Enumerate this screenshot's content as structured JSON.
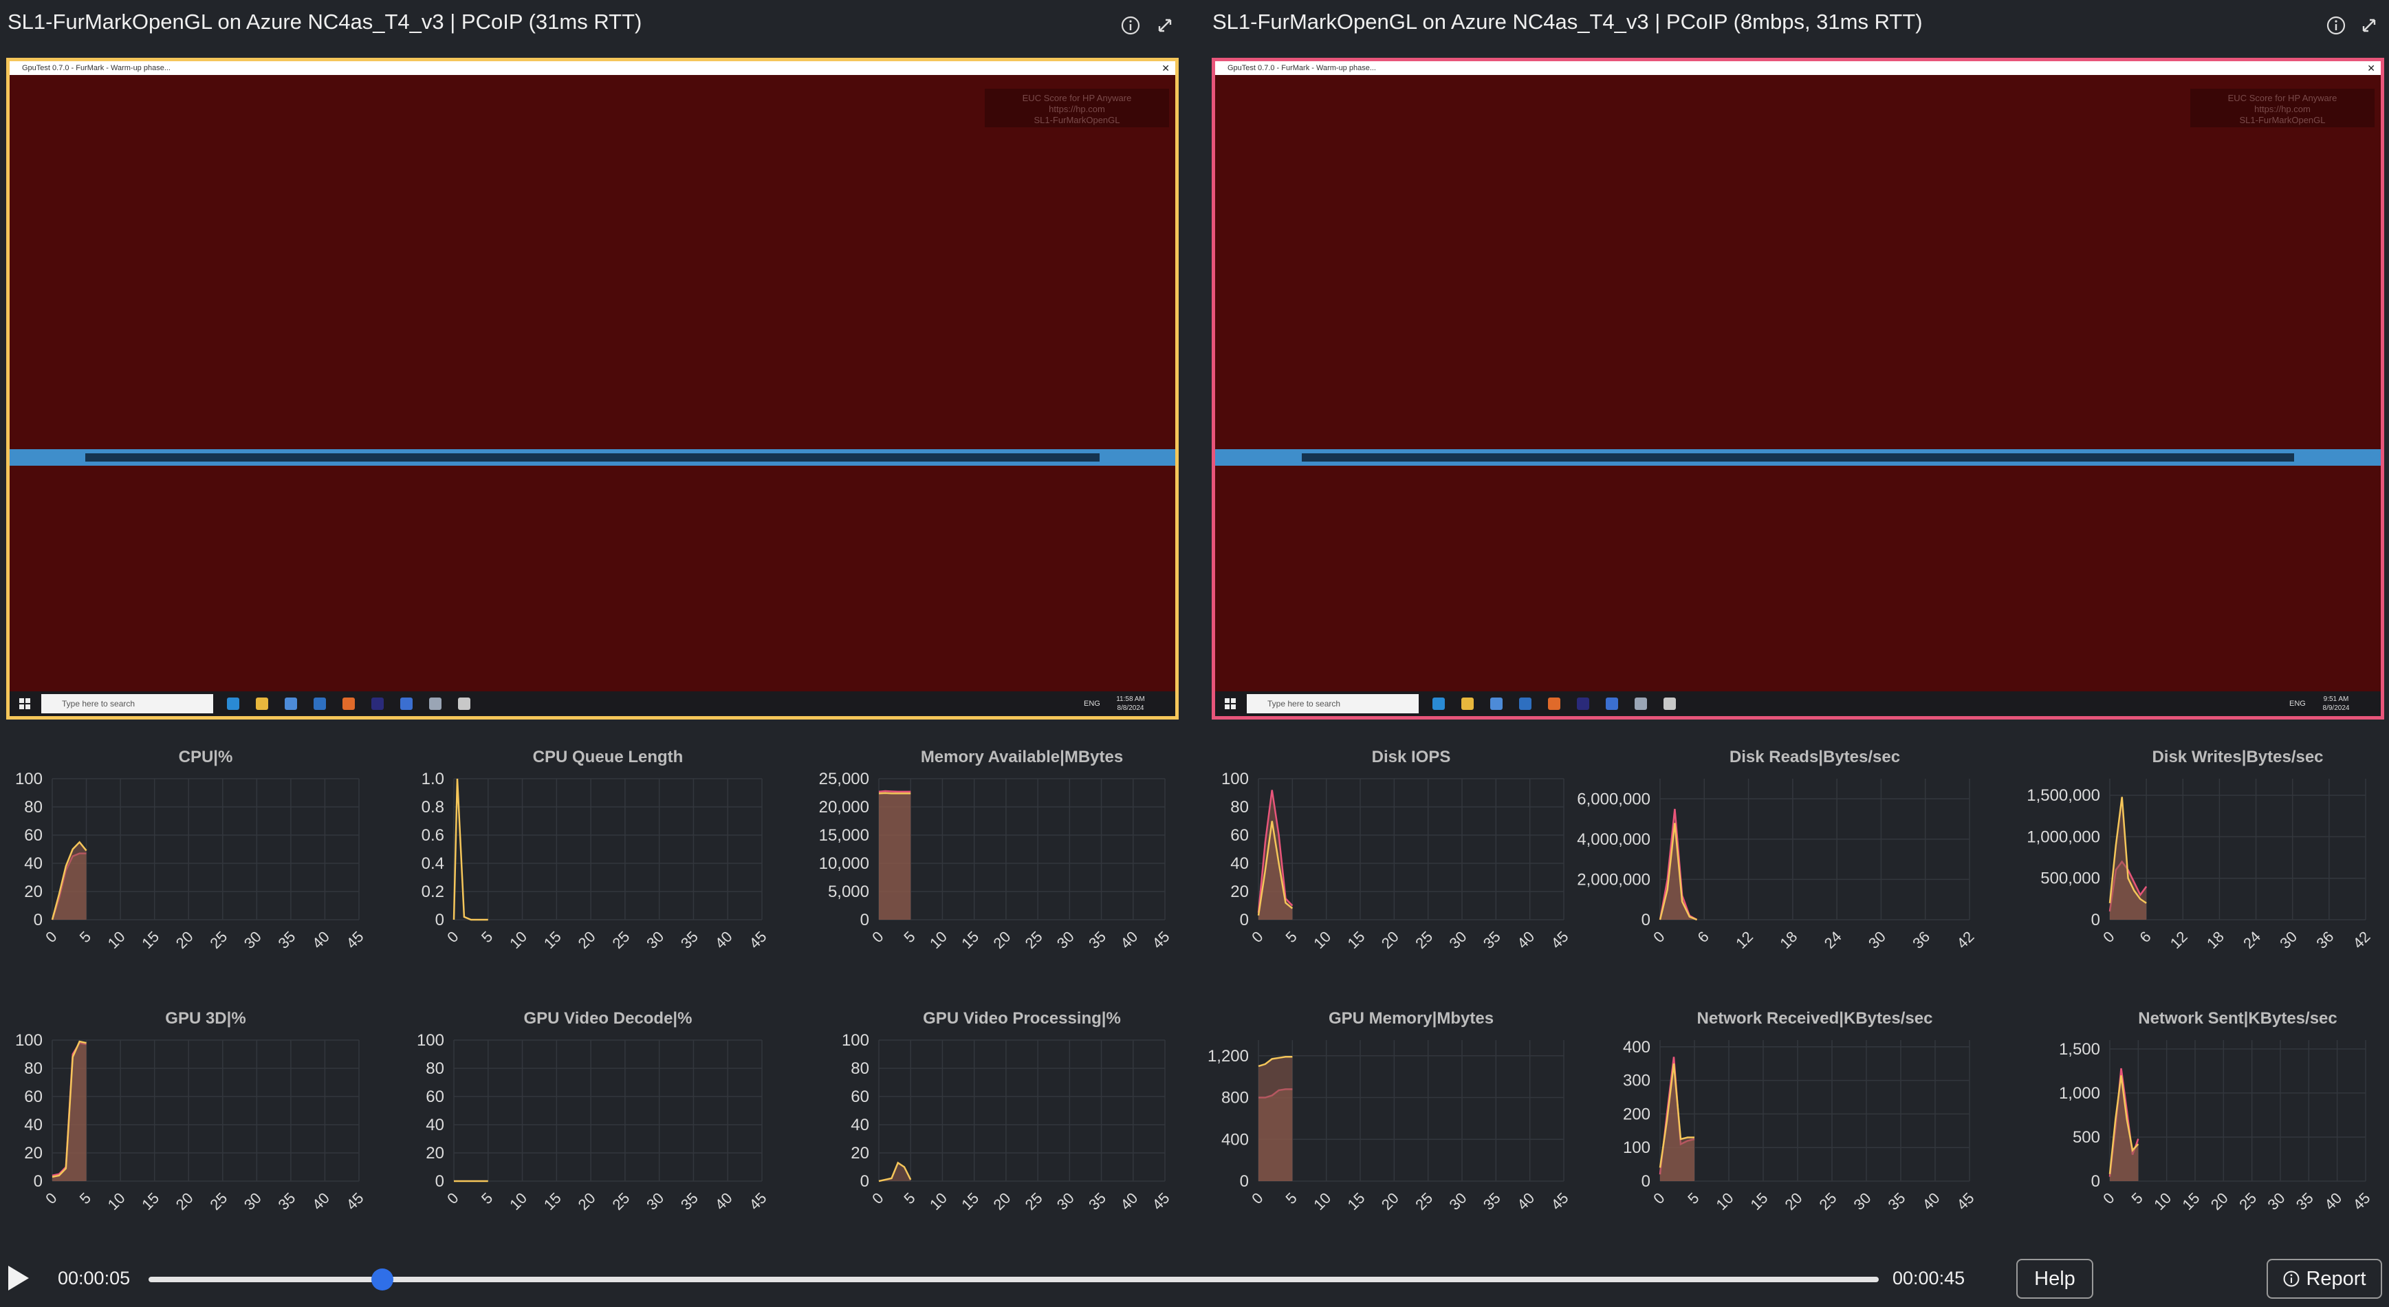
{
  "panels": [
    {
      "title": "SL1-FurMarkOpenGL on Azure NC4as_T4_v3 | PCoIP (31ms RTT)",
      "border_color": "#f5c65a",
      "window_title": "GpuTest 0.7.0 - FurMark - Warm-up phase...",
      "close_glyph": "✕",
      "watermark": [
        "EUC Score for HP Anyware",
        "https://hp.com",
        "SL1-FurMarkOpenGL"
      ],
      "search_placeholder": "Type here to search",
      "tray_lang": "ENG",
      "tray_time": "11:58 AM",
      "tray_date": "8/8/2024"
    },
    {
      "title": "SL1-FurMarkOpenGL on Azure NC4as_T4_v3 | PCoIP (8mbps, 31ms RTT)",
      "border_color": "#e8557a",
      "window_title": "GpuTest 0.7.0 - FurMark - Warm-up phase...",
      "close_glyph": "✕",
      "watermark": [
        "EUC Score for HP Anyware",
        "https://hp.com",
        "SL1-FurMarkOpenGL"
      ],
      "search_placeholder": "Type here to search",
      "tray_lang": "ENG",
      "tray_time": "9:51 AM",
      "tray_date": "8/9/2024"
    }
  ],
  "info_glyph": "ⓘ",
  "expand_glyph": "⤡",
  "colors": {
    "series_a": "#f5c65a",
    "series_b": "#e8557a",
    "fill": "#8b5a4a",
    "background": "#22252a",
    "grid": "#33373d",
    "screen_red": "#4c0909",
    "screen_blue": "#3f8ecb"
  },
  "chart_data": [
    {
      "type": "area",
      "title": "CPU|%",
      "ylim": [
        0,
        100
      ],
      "yticks": [
        "100",
        "80",
        "60",
        "40",
        "20",
        "0"
      ],
      "xlim": [
        0,
        45
      ],
      "xticks": [
        "0",
        "5",
        "10",
        "15",
        "20",
        "25",
        "30",
        "35",
        "40",
        "45"
      ],
      "series": [
        {
          "x": [
            0,
            1,
            2,
            3,
            4,
            5
          ],
          "values": [
            0,
            15,
            35,
            45,
            47,
            47
          ]
        },
        {
          "x": [
            0,
            1,
            2,
            3,
            4,
            5
          ],
          "values": [
            0,
            18,
            38,
            50,
            55,
            49
          ]
        }
      ]
    },
    {
      "type": "line",
      "title": "CPU Queue Length",
      "ylim": [
        0,
        1
      ],
      "yticks": [
        "1.0",
        "0.8",
        "0.6",
        "0.4",
        "0.2",
        "0"
      ],
      "xlim": [
        0,
        45
      ],
      "xticks": [
        "0",
        "5",
        "10",
        "15",
        "20",
        "25",
        "30",
        "35",
        "40",
        "45"
      ],
      "series": [
        {
          "x": [
            0,
            0.5,
            1.5,
            2.5,
            3,
            4,
            5
          ],
          "values": [
            0,
            1,
            0.02,
            0,
            0,
            0,
            0
          ]
        }
      ]
    },
    {
      "type": "area",
      "title": "Memory Available|MBytes",
      "ylim": [
        0,
        25000
      ],
      "yticks": [
        "25,000",
        "20,000",
        "15,000",
        "10,000",
        "5,000",
        "0"
      ],
      "xlim": [
        0,
        45
      ],
      "xticks": [
        "0",
        "5",
        "10",
        "15",
        "20",
        "25",
        "30",
        "35",
        "40",
        "45"
      ],
      "series": [
        {
          "x": [
            0,
            1,
            2,
            3,
            4,
            5
          ],
          "values": [
            22700,
            22800,
            22750,
            22700,
            22700,
            22700
          ]
        },
        {
          "x": [
            0,
            1,
            2,
            3,
            4,
            5
          ],
          "values": [
            22400,
            22450,
            22400,
            22400,
            22400,
            22400
          ]
        }
      ]
    },
    {
      "type": "area",
      "title": "Disk IOPS",
      "ylim": [
        0,
        100
      ],
      "yticks": [
        "100",
        "80",
        "60",
        "40",
        "20",
        "0"
      ],
      "xlim": [
        0,
        45
      ],
      "xticks": [
        "0",
        "5",
        "10",
        "15",
        "20",
        "25",
        "30",
        "35",
        "40",
        "45"
      ],
      "series": [
        {
          "x": [
            0,
            1,
            2,
            3,
            4,
            5
          ],
          "values": [
            5,
            55,
            92,
            60,
            15,
            10
          ]
        },
        {
          "x": [
            0,
            1,
            2,
            3,
            4,
            5
          ],
          "values": [
            3,
            35,
            70,
            40,
            12,
            8
          ]
        }
      ]
    },
    {
      "type": "area",
      "title": "Disk Reads|Bytes/sec",
      "ylim": [
        0,
        7000000
      ],
      "yticks": [
        "6,000,000",
        "4,000,000",
        "2,000,000",
        "0"
      ],
      "ytick_values": [
        6000000,
        4000000,
        2000000,
        0
      ],
      "xlim": [
        0,
        42
      ],
      "xticks": [
        "0",
        "6",
        "12",
        "18",
        "24",
        "30",
        "36",
        "42"
      ],
      "series": [
        {
          "x": [
            0,
            1,
            2,
            3,
            4,
            5
          ],
          "values": [
            0,
            2000000,
            5500000,
            1200000,
            200000,
            0
          ]
        },
        {
          "x": [
            0,
            1,
            2,
            3,
            4,
            5
          ],
          "values": [
            0,
            1500000,
            4800000,
            900000,
            150000,
            0
          ]
        }
      ]
    },
    {
      "type": "area",
      "title": "Disk Writes|Bytes/sec",
      "ylim": [
        0,
        1700000
      ],
      "yticks": [
        "1,500,000",
        "1,000,000",
        "500,000",
        "0"
      ],
      "ytick_values": [
        1500000,
        1000000,
        500000,
        0
      ],
      "xlim": [
        0,
        42
      ],
      "xticks": [
        "0",
        "6",
        "12",
        "18",
        "24",
        "30",
        "36",
        "42"
      ],
      "series": [
        {
          "x": [
            0,
            1,
            2,
            3,
            4,
            5,
            6
          ],
          "values": [
            100000,
            600000,
            700000,
            600000,
            450000,
            300000,
            400000
          ]
        },
        {
          "x": [
            0,
            1,
            2,
            3,
            4,
            5,
            6
          ],
          "values": [
            200000,
            900000,
            1480000,
            500000,
            350000,
            250000,
            200000
          ]
        }
      ]
    },
    {
      "type": "area",
      "title": "GPU 3D|%",
      "ylim": [
        0,
        100
      ],
      "yticks": [
        "100",
        "80",
        "60",
        "40",
        "20",
        "0"
      ],
      "xlim": [
        0,
        45
      ],
      "xticks": [
        "0",
        "5",
        "10",
        "15",
        "20",
        "25",
        "30",
        "35",
        "40",
        "45"
      ],
      "series": [
        {
          "x": [
            0,
            1,
            2,
            3,
            4,
            5
          ],
          "values": [
            4,
            5,
            10,
            90,
            98,
            97
          ]
        },
        {
          "x": [
            0,
            1,
            2,
            3,
            4,
            5
          ],
          "values": [
            3,
            4,
            9,
            88,
            99,
            98
          ]
        }
      ]
    },
    {
      "type": "line",
      "title": "GPU Video Decode|%",
      "ylim": [
        0,
        100
      ],
      "yticks": [
        "100",
        "80",
        "60",
        "40",
        "20",
        "0"
      ],
      "xlim": [
        0,
        45
      ],
      "xticks": [
        "0",
        "5",
        "10",
        "15",
        "20",
        "25",
        "30",
        "35",
        "40",
        "45"
      ],
      "series": [
        {
          "x": [
            0,
            1,
            2,
            3,
            4,
            5
          ],
          "values": [
            0,
            0,
            0,
            0,
            0,
            0
          ]
        }
      ]
    },
    {
      "type": "area",
      "title": "GPU Video Processing|%",
      "ylim": [
        0,
        100
      ],
      "yticks": [
        "100",
        "80",
        "60",
        "40",
        "20",
        "0"
      ],
      "xlim": [
        0,
        45
      ],
      "xticks": [
        "0",
        "5",
        "10",
        "15",
        "20",
        "25",
        "30",
        "35",
        "40",
        "45"
      ],
      "series": [
        {
          "x": [
            0,
            1,
            2,
            3,
            4,
            5
          ],
          "values": [
            0,
            1,
            2,
            13,
            10,
            1
          ]
        }
      ]
    },
    {
      "type": "area",
      "title": "GPU Memory|Mbytes",
      "ylim": [
        0,
        1350
      ],
      "yticks": [
        "1,200",
        "800",
        "400",
        "0"
      ],
      "ytick_values": [
        1200,
        800,
        400,
        0
      ],
      "xlim": [
        0,
        45
      ],
      "xticks": [
        "0",
        "5",
        "10",
        "15",
        "20",
        "25",
        "30",
        "35",
        "40",
        "45"
      ],
      "series": [
        {
          "x": [
            0,
            1,
            2,
            3,
            4,
            5
          ],
          "values": [
            800,
            800,
            820,
            870,
            880,
            880
          ]
        },
        {
          "x": [
            0,
            1,
            2,
            3,
            4,
            5
          ],
          "values": [
            1100,
            1120,
            1170,
            1180,
            1190,
            1190
          ]
        }
      ]
    },
    {
      "type": "area",
      "title": "Network Received|KBytes/sec",
      "ylim": [
        0,
        420
      ],
      "yticks": [
        "400",
        "300",
        "200",
        "100",
        "0"
      ],
      "ytick_values": [
        400,
        300,
        200,
        100,
        0
      ],
      "xlim": [
        0,
        45
      ],
      "xticks": [
        "0",
        "5",
        "10",
        "15",
        "20",
        "25",
        "30",
        "35",
        "40",
        "45"
      ],
      "series": [
        {
          "x": [
            0,
            1,
            2,
            3,
            4,
            5
          ],
          "values": [
            20,
            200,
            370,
            110,
            120,
            125
          ]
        },
        {
          "x": [
            0,
            1,
            2,
            3,
            4,
            5
          ],
          "values": [
            40,
            180,
            350,
            125,
            130,
            130
          ]
        }
      ]
    },
    {
      "type": "area",
      "title": "Network Sent|KBytes/sec",
      "ylim": [
        0,
        1600
      ],
      "yticks": [
        "1,500",
        "1,000",
        "500",
        "0"
      ],
      "ytick_values": [
        1500,
        1000,
        500,
        0
      ],
      "xlim": [
        0,
        45
      ],
      "xticks": [
        "0",
        "5",
        "10",
        "15",
        "20",
        "25",
        "30",
        "35",
        "40",
        "45"
      ],
      "series": [
        {
          "x": [
            0,
            1,
            2,
            3,
            4,
            5
          ],
          "values": [
            50,
            600,
            1280,
            800,
            300,
            480
          ]
        },
        {
          "x": [
            0,
            1,
            2,
            3,
            4,
            5
          ],
          "values": [
            80,
            700,
            1200,
            700,
            350,
            420
          ]
        }
      ]
    }
  ],
  "player": {
    "current_time": "00:00:05",
    "total_time": "00:00:45",
    "progress": 0.135,
    "help_label": "Help",
    "report_label": "Report"
  }
}
